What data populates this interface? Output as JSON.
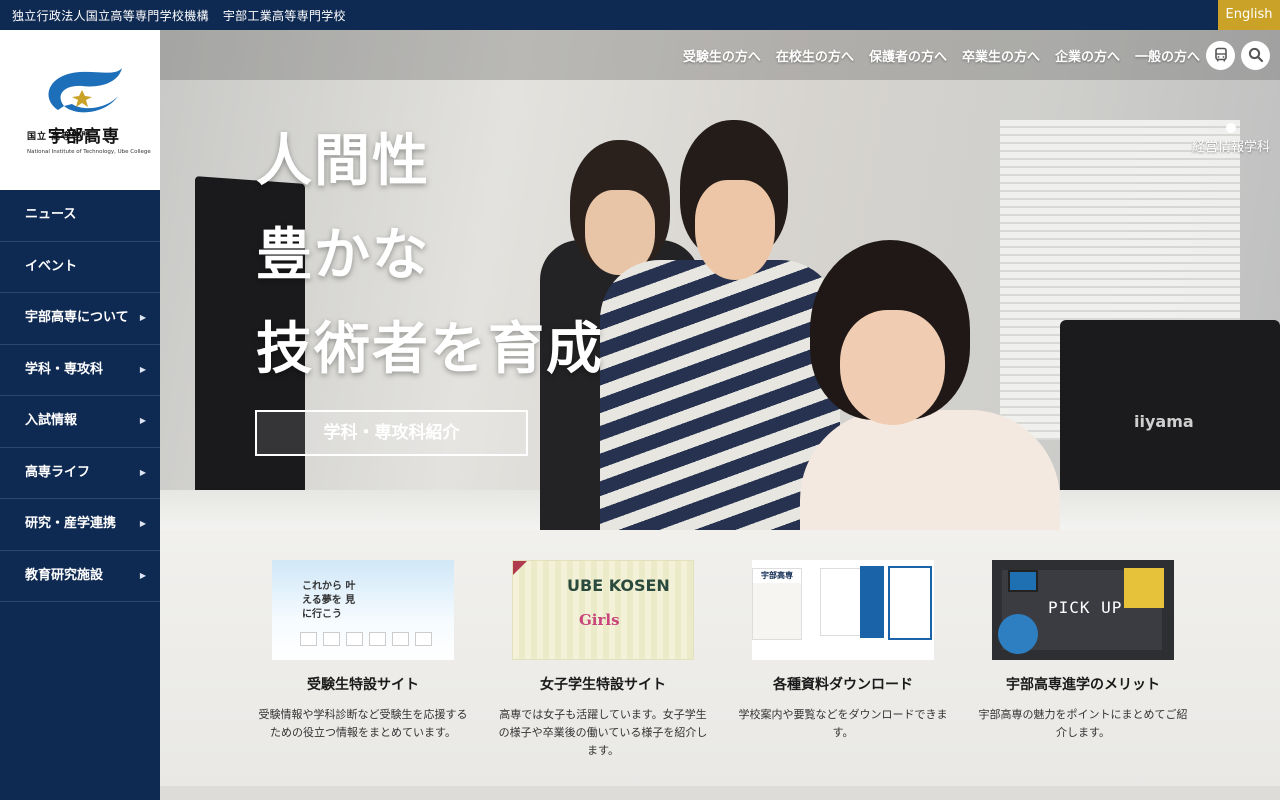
{
  "topbar": {
    "org_name": "独立行政法人国立高等専門学校機構",
    "school_name": "宇部工業高等専門学校",
    "english_label": "English"
  },
  "logo": {
    "prefix": "国立 高等専門",
    "main": "宇部高専",
    "sub": "National Institute of Technology, Ube College"
  },
  "nav": [
    {
      "label": "ニュース",
      "has_submenu": false
    },
    {
      "label": "イベント",
      "has_submenu": false
    },
    {
      "label": "宇部高専について",
      "has_submenu": true
    },
    {
      "label": "学科・専攻科",
      "has_submenu": true
    },
    {
      "label": "入試情報",
      "has_submenu": true
    },
    {
      "label": "高専ライフ",
      "has_submenu": true
    },
    {
      "label": "研究・産学連携",
      "has_submenu": true
    },
    {
      "label": "教育研究施設",
      "has_submenu": true
    }
  ],
  "utility_links": [
    "受験生の方へ",
    "在校生の方へ",
    "保護者の方へ",
    "卒業生の方へ",
    "企業の方へ",
    "一般の方へ"
  ],
  "icons": {
    "access": "bus-icon",
    "search": "search-icon",
    "submenu": "triangle-right-icon"
  },
  "hero": {
    "headline_1": "人間性",
    "headline_2": "豊かな",
    "headline_3": "技術者を育成",
    "cta_label": "学科・専攻科紹介",
    "dept_tag": "経営情報学科",
    "monitor_brand": "iiyama"
  },
  "cards": [
    {
      "title": "受験生特設サイト",
      "description": "受験情報や学科診断など受験生を応援するための役立つ情報をまとめています。",
      "thumb_text": "これから 叶える夢を 見に行こう"
    },
    {
      "title": "女子学生特設サイト",
      "description": "高専では女子も活躍しています。女子学生の様子や卒業後の働いている様子を紹介します。",
      "thumb_text_1": "UBE KOSEN",
      "thumb_text_2": "Girls"
    },
    {
      "title": "各種資料ダウンロード",
      "description": "学校案内や要覧などをダウンロードできます。",
      "thumb_text": "宇部高専"
    },
    {
      "title": "宇部高専進学のメリット",
      "description": "宇部高専の魅力をポイントにまとめてご紹介します。",
      "thumb_text": "PICK UP"
    }
  ],
  "colors": {
    "navy": "#0f2a52",
    "gold": "#c9a227",
    "logo_blue": "#1c6fb8"
  }
}
